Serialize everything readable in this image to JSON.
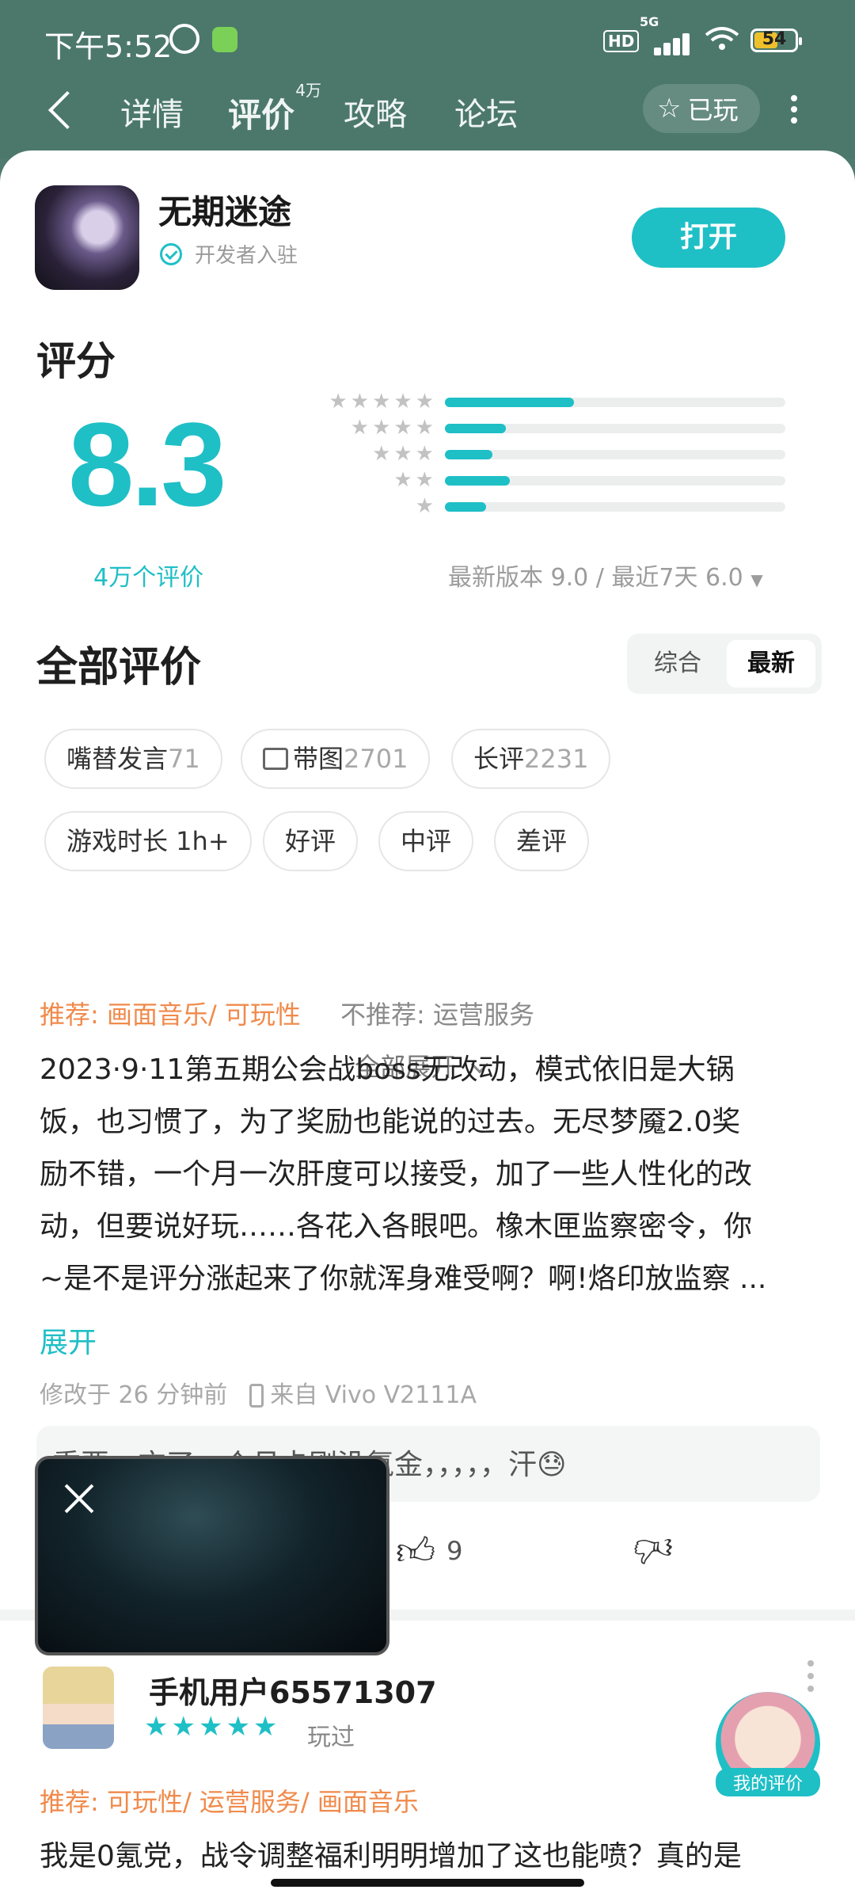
{
  "status": {
    "time": "下午5:52",
    "hd": "HD",
    "signal": "5G",
    "battery": "54"
  },
  "nav": {
    "tabs": [
      {
        "label": "详情"
      },
      {
        "label": "评价",
        "sup": "4万"
      },
      {
        "label": "攻略"
      },
      {
        "label": "论坛"
      }
    ],
    "played_label": "已玩"
  },
  "app": {
    "name": "无期迷途",
    "verify": "开发者入驻",
    "open_label": "打开"
  },
  "rating": {
    "title": "评分",
    "score": "8.3",
    "count": "4万个评价",
    "distribution": [
      {
        "stars": 5,
        "fraction": 0.38
      },
      {
        "stars": 4,
        "fraction": 0.18
      },
      {
        "stars": 3,
        "fraction": 0.14
      },
      {
        "stars": 2,
        "fraction": 0.19
      },
      {
        "stars": 1,
        "fraction": 0.12
      }
    ],
    "version_note": "最新版本 9.0 / 最近7天 6.0"
  },
  "reviews_section": {
    "title": "全部评价",
    "sort_options": [
      "综合",
      "最新"
    ],
    "sort_selected": "最新",
    "chips": [
      {
        "label": "嘴替发言",
        "count": "71"
      },
      {
        "label": "带图",
        "count": "2701",
        "icon": "image-icon"
      },
      {
        "label": "长评",
        "count": "2231"
      },
      {
        "label": "游戏时长 1h+",
        "count": ""
      },
      {
        "label": "好评",
        "count": ""
      },
      {
        "label": "中评",
        "count": ""
      },
      {
        "label": "差评",
        "count": ""
      }
    ],
    "expand_all": "全部展开"
  },
  "review1": {
    "recommend": "推荐: 画面音乐/ 可玩性",
    "not_recommend": "不推荐: 运营服务",
    "lines": [
      "2023·9·11第五期公会战boss无改动，模式依旧是大锅",
      "饭，也习惯了，为了奖励也能说的过去。无尽梦魇2.0奖",
      "励不错，一个月一次肝度可以接受，加了一些人性化的改",
      "动，但要说好玩……各花入各眼吧。橡木匣监察密令，你",
      "~是不是评分涨起来了你就浑身难受啊？啊!烙印放监察 ..."
    ],
    "expand": "展开",
    "modified": "修改于 26 分钟前",
    "device": "来自 Vivo V2111A",
    "reply": "重要，充了一个月卡刚没氪金，，，，，汗😓",
    "likes": "9"
  },
  "review2": {
    "user": "手机用户65571307",
    "stars": "★★★★★",
    "played": "玩过",
    "recommend": "推荐: 可玩性/ 运营服务/ 画面音乐",
    "text": "我是0氪党，战令调整福利明明增加了这也能喷？真的是"
  },
  "my_rating_label": "我的评价"
}
